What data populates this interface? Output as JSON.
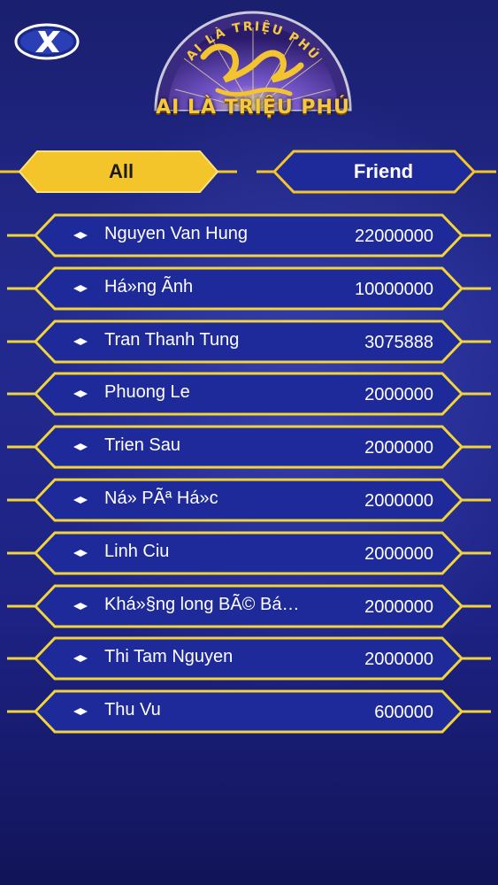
{
  "header": {
    "logo_arc_text": "AI LÀ TRIỆU PHÚ",
    "logo_caption": "AI LÀ TRIỆU PHÚ",
    "close_icon": "x-close-icon"
  },
  "tabs": [
    {
      "label": "All",
      "active": true
    },
    {
      "label": "Friend",
      "active": false
    }
  ],
  "colors": {
    "accent_gold": "#f3c52a",
    "row_border": "#f0d43a",
    "row_fill": "#1f2a9a",
    "background": "#1d2284"
  },
  "leaderboard": {
    "rows": [
      {
        "name": "Nguyen Van Hung",
        "score": "22000000"
      },
      {
        "name": "Há»ng Ãnh",
        "score": "10000000"
      },
      {
        "name": "Tran Thanh Tung",
        "score": "3075888"
      },
      {
        "name": "Phuong Le",
        "score": "2000000"
      },
      {
        "name": "Trien Sau",
        "score": "2000000"
      },
      {
        "name": "Ná» PÃª Há»c",
        "score": "2000000"
      },
      {
        "name": "Linh Ciu",
        "score": "2000000"
      },
      {
        "name": "Khá»§ng long BÃ© Bá…",
        "score": "2000000"
      },
      {
        "name": "Thi Tam Nguyen",
        "score": "2000000"
      },
      {
        "name": "Thu Vu",
        "score": "600000"
      }
    ]
  }
}
